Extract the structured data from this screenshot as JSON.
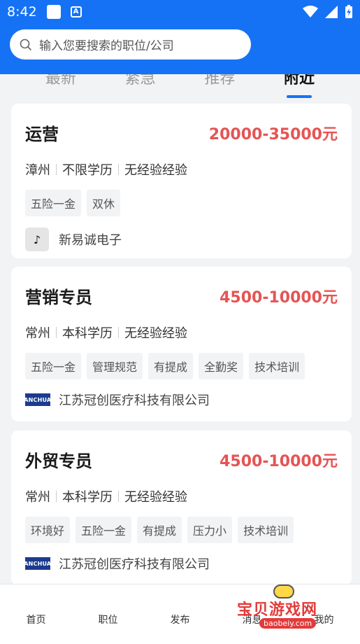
{
  "status_bar": {
    "time": "8:42",
    "a_badge": "A"
  },
  "search": {
    "placeholder": "输入您要搜索的职位/公司"
  },
  "tabs": [
    {
      "label": "最新"
    },
    {
      "label": "紧急"
    },
    {
      "label": "推荐"
    },
    {
      "label": "附近"
    }
  ],
  "jobs": [
    {
      "title": "运营",
      "salary": "20000-35000元",
      "city": "漳州",
      "education": "不限学历",
      "experience": "无经验经验",
      "tags": [
        "五险一金",
        "双休"
      ],
      "company": "新易诚电子",
      "logo_text": "♪"
    },
    {
      "title": "营销专员",
      "salary": "4500-10000元",
      "city": "常州",
      "education": "本科学历",
      "experience": "无经验经验",
      "tags": [
        "五险一金",
        "管理规范",
        "有提成",
        "全勤奖",
        "技术培训"
      ],
      "company": "江苏冠创医疗科技有限公司",
      "logo_text": "GUANCHUANG"
    },
    {
      "title": "外贸专员",
      "salary": "4500-10000元",
      "city": "常州",
      "education": "本科学历",
      "experience": "无经验经验",
      "tags": [
        "环境好",
        "五险一金",
        "有提成",
        "压力小",
        "技术培训"
      ],
      "company": "江苏冠创医疗科技有限公司",
      "logo_text": "GUANCHUANG"
    }
  ],
  "bottom_nav": [
    {
      "label": "首页"
    },
    {
      "label": "职位"
    },
    {
      "label": "发布"
    },
    {
      "label": "消息"
    },
    {
      "label": "我的"
    }
  ],
  "watermark": {
    "title": "宝贝游戏网",
    "url": "baobeiy.com"
  },
  "colors": {
    "primary": "#1672f5",
    "salary": "#e65454"
  }
}
